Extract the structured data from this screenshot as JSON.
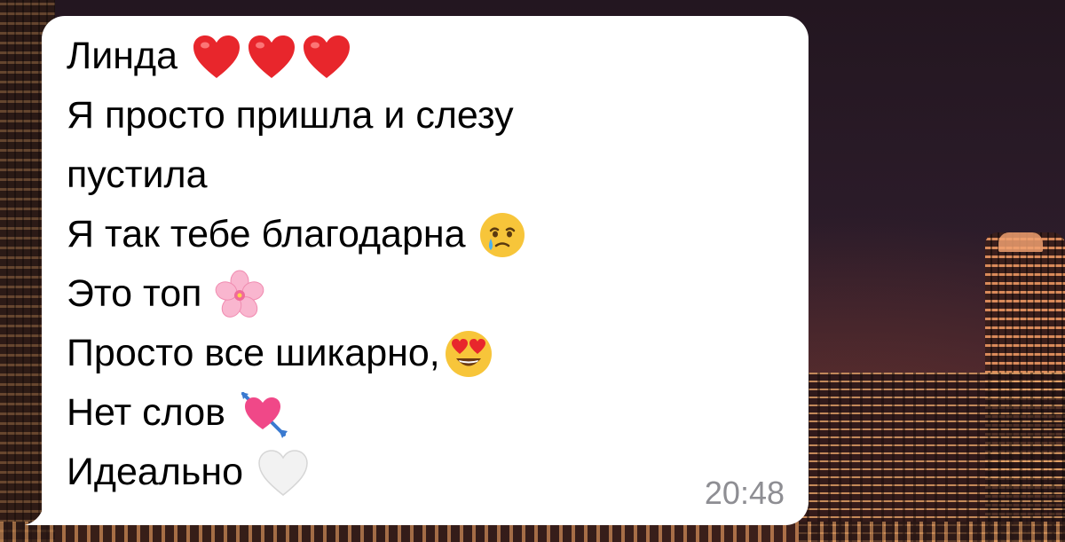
{
  "message": {
    "lines": [
      {
        "text": "Линда",
        "emoji": [
          "red-heart",
          "red-heart",
          "red-heart"
        ]
      },
      {
        "text": "Я просто пришла и слезу"
      },
      {
        "text": "пустила"
      },
      {
        "text": "Я так тебе благодарна",
        "emoji": [
          "holding-back-tears"
        ]
      },
      {
        "text": "Это топ",
        "emoji": [
          "cherry-blossom"
        ]
      },
      {
        "text": "Просто все шикарно,",
        "emoji": [
          "heart-eyes"
        ]
      },
      {
        "text": "Нет слов",
        "emoji": [
          "heart-with-arrow"
        ]
      },
      {
        "text": "Идеально",
        "emoji": [
          "white-heart"
        ]
      }
    ],
    "time": "20:48"
  },
  "colors": {
    "bubble": "#ffffff",
    "text": "#000000",
    "time": "#8e8e93"
  }
}
